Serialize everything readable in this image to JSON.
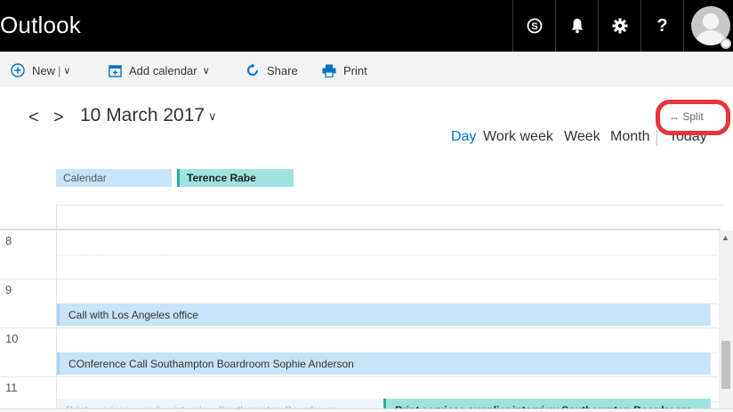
{
  "header": {
    "app_title": "Outlook",
    "buttons": [
      {
        "name": "skype",
        "icon": "skype-icon"
      },
      {
        "name": "notifications",
        "icon": "bell-icon"
      },
      {
        "name": "settings",
        "icon": "gear-icon"
      },
      {
        "name": "help",
        "label": "?",
        "icon": "help-icon"
      }
    ],
    "avatar_icon": "user-avatar-icon"
  },
  "toolbar": {
    "new_label": "New",
    "new_separator": "|",
    "add_calendar_label": "Add calendar",
    "share_label": "Share",
    "print_label": "Print"
  },
  "navigation": {
    "prev": "<",
    "next": ">",
    "date": "10 March 2017",
    "split_label": "Split",
    "split_arrow": "↔",
    "views": [
      "Day",
      "Work week",
      "Week",
      "Month",
      "Today"
    ],
    "active_view": "Day"
  },
  "calendars": [
    {
      "label": "Calendar",
      "color": "#c7e4f8"
    },
    {
      "label": "Terence Rabe",
      "color": "#9fe3dd"
    }
  ],
  "hours": [
    "8",
    "9",
    "10",
    "11"
  ],
  "events": [
    {
      "title": "Call with Los Angeles office"
    },
    {
      "title": "COnference Call Southampton Boardroom Sophie Anderson"
    },
    {
      "title": "Print services supplier interview Southampton Boardroom"
    },
    {
      "title": "Print services supplier interview Southampton Boardroom"
    }
  ],
  "colors": {
    "accent": "#0072c6",
    "topbar": "#000000",
    "highlight": "#e8343a",
    "event_blue": "#c7e4f8",
    "event_teal": "#9fe3dd"
  }
}
